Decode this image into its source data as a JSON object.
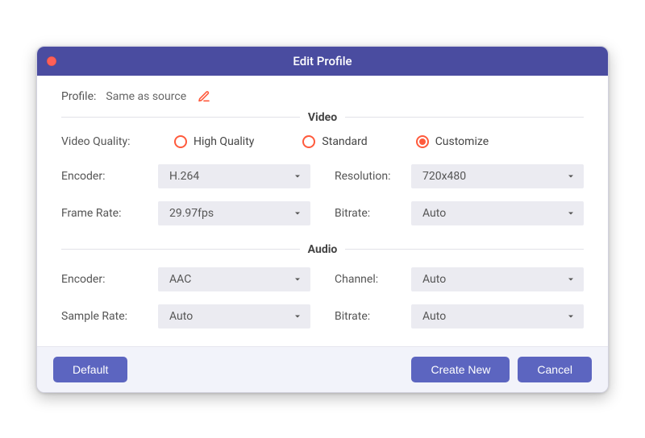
{
  "window": {
    "title": "Edit Profile"
  },
  "profile": {
    "label": "Profile:",
    "value": "Same as source"
  },
  "sections": {
    "video": "Video",
    "audio": "Audio"
  },
  "video": {
    "quality_label": "Video Quality:",
    "options": {
      "high": "High Quality",
      "standard": "Standard",
      "customize": "Customize"
    },
    "selected_quality": "customize",
    "encoder_label": "Encoder:",
    "encoder_value": "H.264",
    "frame_rate_label": "Frame Rate:",
    "frame_rate_value": "29.97fps",
    "resolution_label": "Resolution:",
    "resolution_value": "720x480",
    "bitrate_label": "Bitrate:",
    "bitrate_value": "Auto"
  },
  "audio": {
    "encoder_label": "Encoder:",
    "encoder_value": "AAC",
    "sample_rate_label": "Sample Rate:",
    "sample_rate_value": "Auto",
    "channel_label": "Channel:",
    "channel_value": "Auto",
    "bitrate_label": "Bitrate:",
    "bitrate_value": "Auto"
  },
  "buttons": {
    "default": "Default",
    "create_new": "Create New",
    "cancel": "Cancel"
  },
  "colors": {
    "accent": "#ff5a3c",
    "primary": "#5c65c0",
    "titlebar": "#4a4ca0"
  }
}
